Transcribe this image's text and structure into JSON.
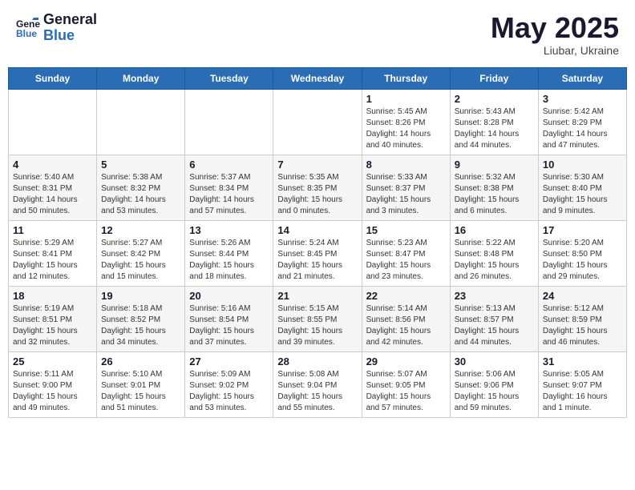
{
  "header": {
    "logo_general": "General",
    "logo_blue": "Blue",
    "month_title": "May 2025",
    "subtitle": "Liubar, Ukraine"
  },
  "weekdays": [
    "Sunday",
    "Monday",
    "Tuesday",
    "Wednesday",
    "Thursday",
    "Friday",
    "Saturday"
  ],
  "weeks": [
    [
      {
        "day": "",
        "sunrise": "",
        "sunset": "",
        "daylight": ""
      },
      {
        "day": "",
        "sunrise": "",
        "sunset": "",
        "daylight": ""
      },
      {
        "day": "",
        "sunrise": "",
        "sunset": "",
        "daylight": ""
      },
      {
        "day": "",
        "sunrise": "",
        "sunset": "",
        "daylight": ""
      },
      {
        "day": "1",
        "sunrise": "Sunrise: 5:45 AM",
        "sunset": "Sunset: 8:26 PM",
        "daylight": "Daylight: 14 hours and 40 minutes."
      },
      {
        "day": "2",
        "sunrise": "Sunrise: 5:43 AM",
        "sunset": "Sunset: 8:28 PM",
        "daylight": "Daylight: 14 hours and 44 minutes."
      },
      {
        "day": "3",
        "sunrise": "Sunrise: 5:42 AM",
        "sunset": "Sunset: 8:29 PM",
        "daylight": "Daylight: 14 hours and 47 minutes."
      }
    ],
    [
      {
        "day": "4",
        "sunrise": "Sunrise: 5:40 AM",
        "sunset": "Sunset: 8:31 PM",
        "daylight": "Daylight: 14 hours and 50 minutes."
      },
      {
        "day": "5",
        "sunrise": "Sunrise: 5:38 AM",
        "sunset": "Sunset: 8:32 PM",
        "daylight": "Daylight: 14 hours and 53 minutes."
      },
      {
        "day": "6",
        "sunrise": "Sunrise: 5:37 AM",
        "sunset": "Sunset: 8:34 PM",
        "daylight": "Daylight: 14 hours and 57 minutes."
      },
      {
        "day": "7",
        "sunrise": "Sunrise: 5:35 AM",
        "sunset": "Sunset: 8:35 PM",
        "daylight": "Daylight: 15 hours and 0 minutes."
      },
      {
        "day": "8",
        "sunrise": "Sunrise: 5:33 AM",
        "sunset": "Sunset: 8:37 PM",
        "daylight": "Daylight: 15 hours and 3 minutes."
      },
      {
        "day": "9",
        "sunrise": "Sunrise: 5:32 AM",
        "sunset": "Sunset: 8:38 PM",
        "daylight": "Daylight: 15 hours and 6 minutes."
      },
      {
        "day": "10",
        "sunrise": "Sunrise: 5:30 AM",
        "sunset": "Sunset: 8:40 PM",
        "daylight": "Daylight: 15 hours and 9 minutes."
      }
    ],
    [
      {
        "day": "11",
        "sunrise": "Sunrise: 5:29 AM",
        "sunset": "Sunset: 8:41 PM",
        "daylight": "Daylight: 15 hours and 12 minutes."
      },
      {
        "day": "12",
        "sunrise": "Sunrise: 5:27 AM",
        "sunset": "Sunset: 8:42 PM",
        "daylight": "Daylight: 15 hours and 15 minutes."
      },
      {
        "day": "13",
        "sunrise": "Sunrise: 5:26 AM",
        "sunset": "Sunset: 8:44 PM",
        "daylight": "Daylight: 15 hours and 18 minutes."
      },
      {
        "day": "14",
        "sunrise": "Sunrise: 5:24 AM",
        "sunset": "Sunset: 8:45 PM",
        "daylight": "Daylight: 15 hours and 21 minutes."
      },
      {
        "day": "15",
        "sunrise": "Sunrise: 5:23 AM",
        "sunset": "Sunset: 8:47 PM",
        "daylight": "Daylight: 15 hours and 23 minutes."
      },
      {
        "day": "16",
        "sunrise": "Sunrise: 5:22 AM",
        "sunset": "Sunset: 8:48 PM",
        "daylight": "Daylight: 15 hours and 26 minutes."
      },
      {
        "day": "17",
        "sunrise": "Sunrise: 5:20 AM",
        "sunset": "Sunset: 8:50 PM",
        "daylight": "Daylight: 15 hours and 29 minutes."
      }
    ],
    [
      {
        "day": "18",
        "sunrise": "Sunrise: 5:19 AM",
        "sunset": "Sunset: 8:51 PM",
        "daylight": "Daylight: 15 hours and 32 minutes."
      },
      {
        "day": "19",
        "sunrise": "Sunrise: 5:18 AM",
        "sunset": "Sunset: 8:52 PM",
        "daylight": "Daylight: 15 hours and 34 minutes."
      },
      {
        "day": "20",
        "sunrise": "Sunrise: 5:16 AM",
        "sunset": "Sunset: 8:54 PM",
        "daylight": "Daylight: 15 hours and 37 minutes."
      },
      {
        "day": "21",
        "sunrise": "Sunrise: 5:15 AM",
        "sunset": "Sunset: 8:55 PM",
        "daylight": "Daylight: 15 hours and 39 minutes."
      },
      {
        "day": "22",
        "sunrise": "Sunrise: 5:14 AM",
        "sunset": "Sunset: 8:56 PM",
        "daylight": "Daylight: 15 hours and 42 minutes."
      },
      {
        "day": "23",
        "sunrise": "Sunrise: 5:13 AM",
        "sunset": "Sunset: 8:57 PM",
        "daylight": "Daylight: 15 hours and 44 minutes."
      },
      {
        "day": "24",
        "sunrise": "Sunrise: 5:12 AM",
        "sunset": "Sunset: 8:59 PM",
        "daylight": "Daylight: 15 hours and 46 minutes."
      }
    ],
    [
      {
        "day": "25",
        "sunrise": "Sunrise: 5:11 AM",
        "sunset": "Sunset: 9:00 PM",
        "daylight": "Daylight: 15 hours and 49 minutes."
      },
      {
        "day": "26",
        "sunrise": "Sunrise: 5:10 AM",
        "sunset": "Sunset: 9:01 PM",
        "daylight": "Daylight: 15 hours and 51 minutes."
      },
      {
        "day": "27",
        "sunrise": "Sunrise: 5:09 AM",
        "sunset": "Sunset: 9:02 PM",
        "daylight": "Daylight: 15 hours and 53 minutes."
      },
      {
        "day": "28",
        "sunrise": "Sunrise: 5:08 AM",
        "sunset": "Sunset: 9:04 PM",
        "daylight": "Daylight: 15 hours and 55 minutes."
      },
      {
        "day": "29",
        "sunrise": "Sunrise: 5:07 AM",
        "sunset": "Sunset: 9:05 PM",
        "daylight": "Daylight: 15 hours and 57 minutes."
      },
      {
        "day": "30",
        "sunrise": "Sunrise: 5:06 AM",
        "sunset": "Sunset: 9:06 PM",
        "daylight": "Daylight: 15 hours and 59 minutes."
      },
      {
        "day": "31",
        "sunrise": "Sunrise: 5:05 AM",
        "sunset": "Sunset: 9:07 PM",
        "daylight": "Daylight: 16 hours and 1 minute."
      }
    ]
  ]
}
